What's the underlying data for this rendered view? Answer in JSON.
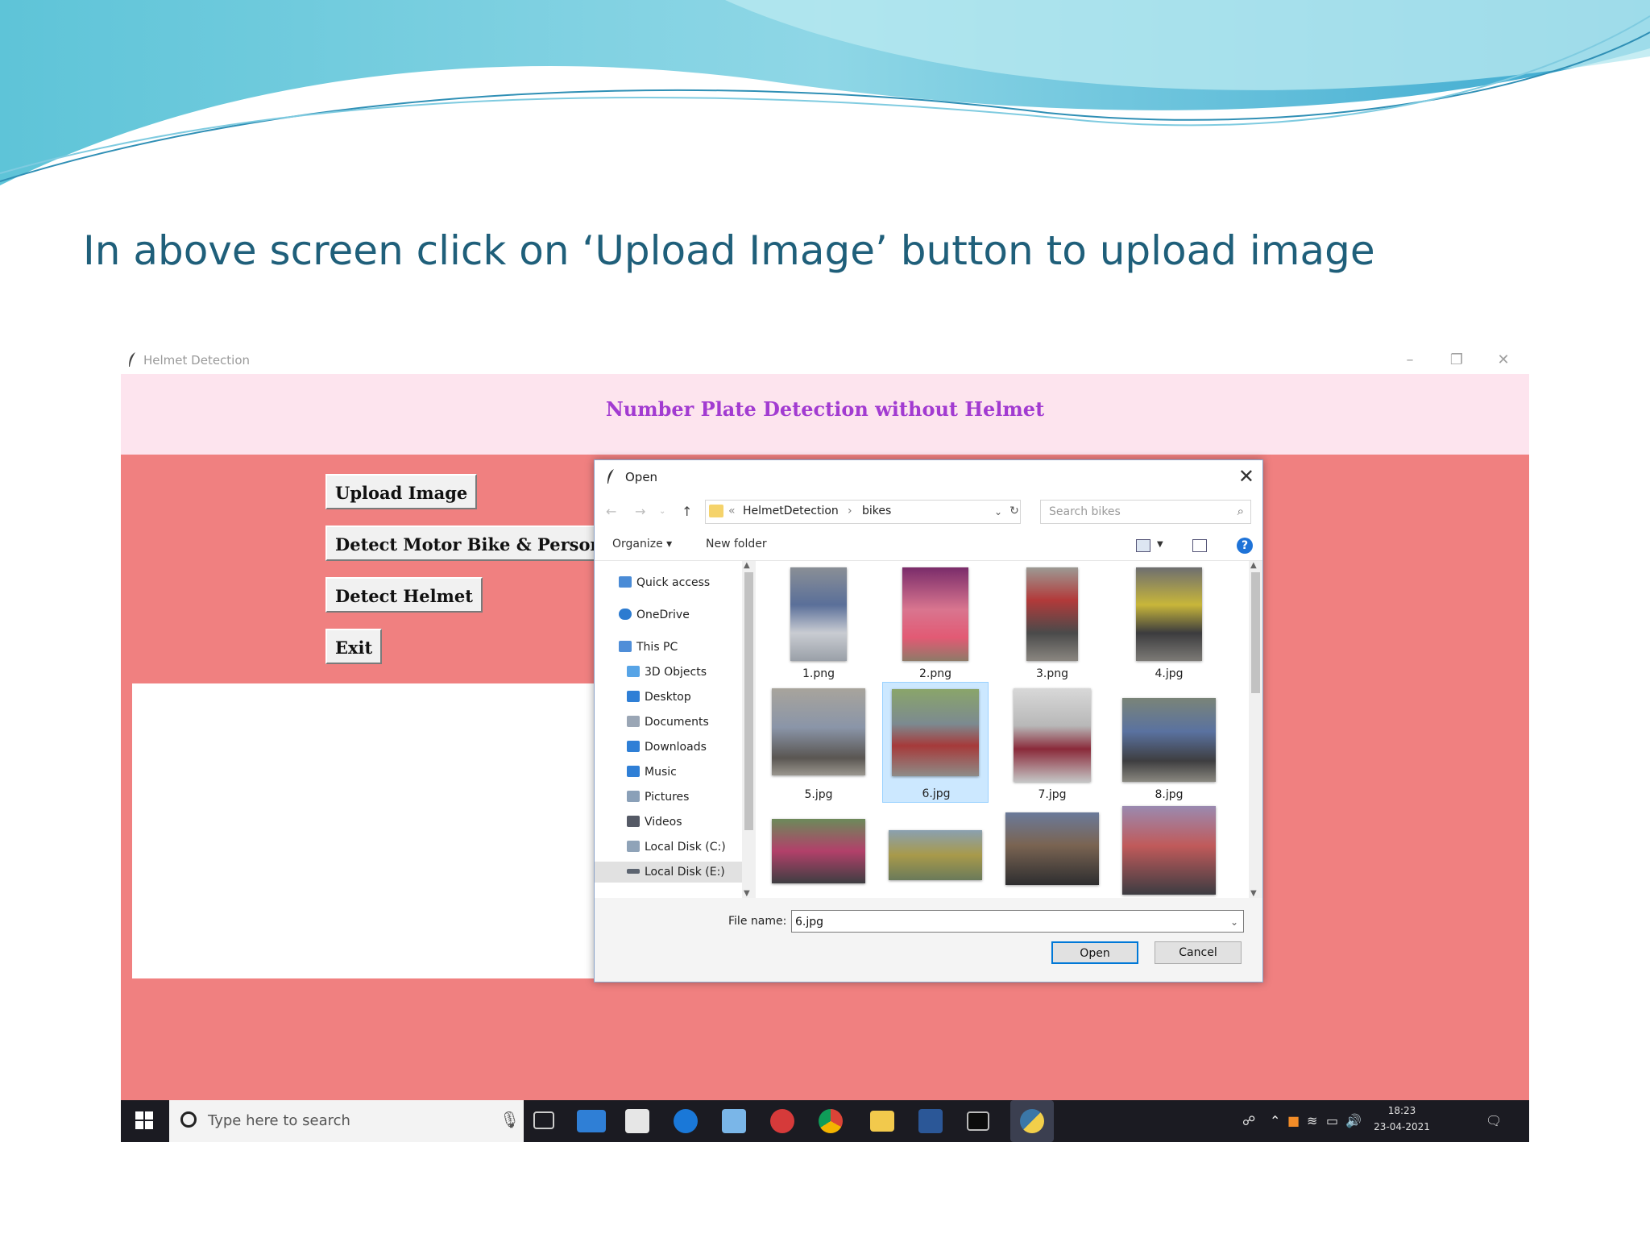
{
  "slide": {
    "caption": "In above screen click on ‘Upload Image’ button to upload image"
  },
  "app": {
    "window_title": "Helmet Detection",
    "heading": "Number Plate Detection without Helmet",
    "buttons": {
      "upload": "Upload Image",
      "detect_bike": "Detect Motor Bike & Person",
      "detect_helmet": "Detect Helmet",
      "exit": "Exit"
    },
    "heading_color": "#a23bd1",
    "background_color": "#f08080"
  },
  "dialog": {
    "title": "Open",
    "breadcrumb": [
      "HelmetDetection",
      "bikes"
    ],
    "search_placeholder": "Search bikes",
    "toolbar": {
      "organize": "Organize ▾",
      "new_folder": "New folder"
    },
    "nav_items": [
      {
        "label": "Quick access",
        "icon": "star-icon",
        "color": "#4a8bd6"
      },
      {
        "label": "OneDrive",
        "icon": "cloud-icon",
        "color": "#2c7bd0"
      },
      {
        "label": "This PC",
        "icon": "computer-icon",
        "color": "#4f8ed8"
      },
      {
        "label": "3D Objects",
        "icon": "cube-icon",
        "color": "#57a4e6"
      },
      {
        "label": "Desktop",
        "icon": "desktop-icon",
        "color": "#2f7fd6"
      },
      {
        "label": "Documents",
        "icon": "document-icon",
        "color": "#9aa6b5"
      },
      {
        "label": "Downloads",
        "icon": "download-icon",
        "color": "#2f7fd6"
      },
      {
        "label": "Music",
        "icon": "music-icon",
        "color": "#2f7fd6"
      },
      {
        "label": "Pictures",
        "icon": "picture-icon",
        "color": "#8aa0b8"
      },
      {
        "label": "Videos",
        "icon": "video-icon",
        "color": "#555a66"
      },
      {
        "label": "Local Disk (C:)",
        "icon": "drive-icon",
        "color": "#8fa3b8"
      },
      {
        "label": "Local Disk (E:)",
        "icon": "drive-icon",
        "color": "#5c6470"
      }
    ],
    "selected_nav": "Local Disk (E:)",
    "files": [
      {
        "name": "1.png"
      },
      {
        "name": "2.png"
      },
      {
        "name": "3.png"
      },
      {
        "name": "4.jpg"
      },
      {
        "name": "5.jpg"
      },
      {
        "name": "6.jpg"
      },
      {
        "name": "7.jpg"
      },
      {
        "name": "8.jpg"
      },
      {
        "name": ""
      },
      {
        "name": ""
      },
      {
        "name": ""
      },
      {
        "name": ""
      }
    ],
    "selected_file": "6.jpg",
    "file_name_label": "File name:",
    "file_name_value": "6.jpg",
    "open_label": "Open",
    "cancel_label": "Cancel"
  },
  "taskbar": {
    "search_placeholder": "Type here to search",
    "time": "18:23",
    "date": "23-04-2021",
    "apps": [
      "task-view-icon",
      "mail-icon",
      "store-icon",
      "edge-icon",
      "notepad-icon",
      "media-icon",
      "chrome-icon",
      "explorer-icon",
      "word-icon",
      "terminal-icon",
      "python-icon"
    ]
  }
}
